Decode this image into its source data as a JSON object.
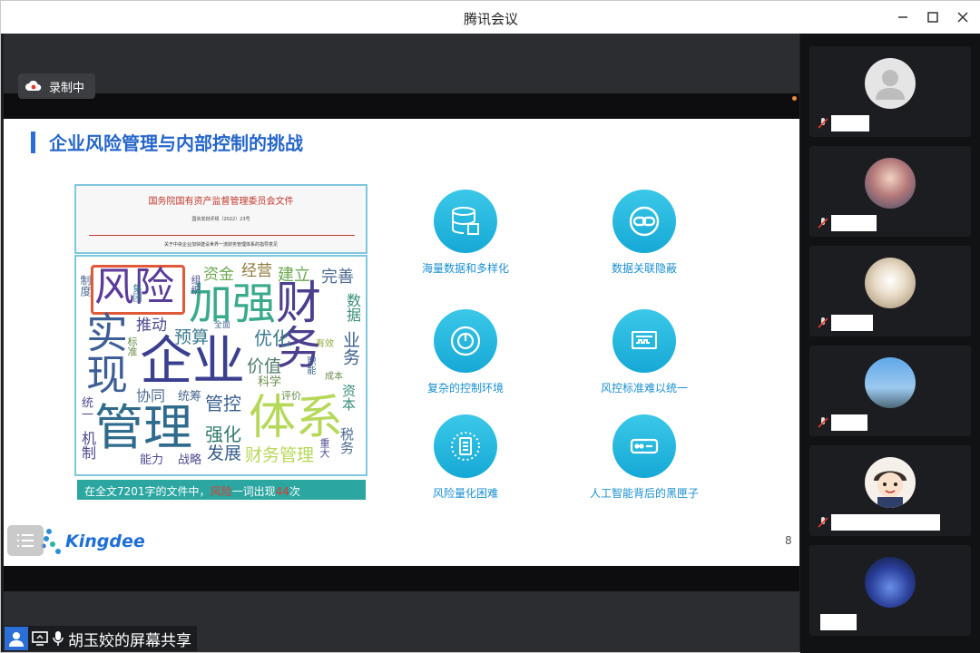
{
  "app": {
    "title": "腾讯会议"
  },
  "window_controls": {
    "minimize_icon": "minimize-icon",
    "maximize_icon": "maximize-icon",
    "close_icon": "close-icon"
  },
  "recording": {
    "label": "录制中",
    "icon": "cloud-record-icon"
  },
  "slide": {
    "title": "企业风险管理与内部控制的挑战",
    "page_number": "8",
    "document": {
      "org": "国务院国有资产监督管理委员会文件",
      "doc_number": "国资发财评规〔2022〕23号",
      "subtitle": "关于中央企业加快建设世界一流财务管理体系的指导意见"
    },
    "wordcloud": {
      "w1": "风险",
      "w2": "加强",
      "w3": "财务",
      "w4": "实现",
      "w5": "企业",
      "w6": "管理",
      "w7": "体系",
      "w8": "资金",
      "w9": "经营",
      "w10": "建立",
      "w11": "完善",
      "w12": "推动",
      "w13": "预算",
      "w14": "优化",
      "w15": "价值",
      "w16": "协同",
      "w17": "管控",
      "w18": "强化",
      "w19": "发展",
      "w20": "财务管理",
      "w21": "统筹",
      "w22": "能力",
      "w23": "战略",
      "w24": "数据",
      "w25": "业务",
      "w26": "资本",
      "w27": "科学",
      "w28": "评价",
      "w29": "统一",
      "w30": "机制",
      "w31": "重大",
      "w32": "税务",
      "w33": "有效",
      "w34": "标准",
      "w35": "成本",
      "w36": "制度",
      "w37": "全面",
      "w38": "集团",
      "w39": "组织",
      "w40": "职能"
    },
    "stat": {
      "prefix": "在全文7201字的文件中，",
      "keyword": "风险",
      "middle": "一词出现",
      "count": "44",
      "suffix": "次"
    },
    "features": [
      {
        "label": "海量数据和多样化",
        "icon": "database-icon"
      },
      {
        "label": "数据关联隐蔽",
        "icon": "link-icon"
      },
      {
        "label": "复杂的控制环境",
        "icon": "gauge-icon"
      },
      {
        "label": "风控标准难以统一",
        "icon": "monitor-icon"
      },
      {
        "label": "风险量化困难",
        "icon": "chip-icon"
      },
      {
        "label": "人工智能背后的黑匣子",
        "icon": "router-box-icon"
      }
    ],
    "logo": "Kingdee"
  },
  "presenter": {
    "label": "胡玉姣的屏幕共享"
  },
  "participants": [
    {
      "avatar": "default-avatar"
    },
    {
      "avatar": "family-photo-avatar"
    },
    {
      "avatar": "chandelier-avatar"
    },
    {
      "avatar": "sky-photo-avatar"
    },
    {
      "avatar": "cartoon-boy-avatar"
    },
    {
      "avatar": "crowd-photo-avatar"
    }
  ],
  "colors": {
    "accent": "#2666c9",
    "feature": "#16a9d6",
    "teal": "#2ba6a0",
    "highlight": "#e23b2e"
  }
}
